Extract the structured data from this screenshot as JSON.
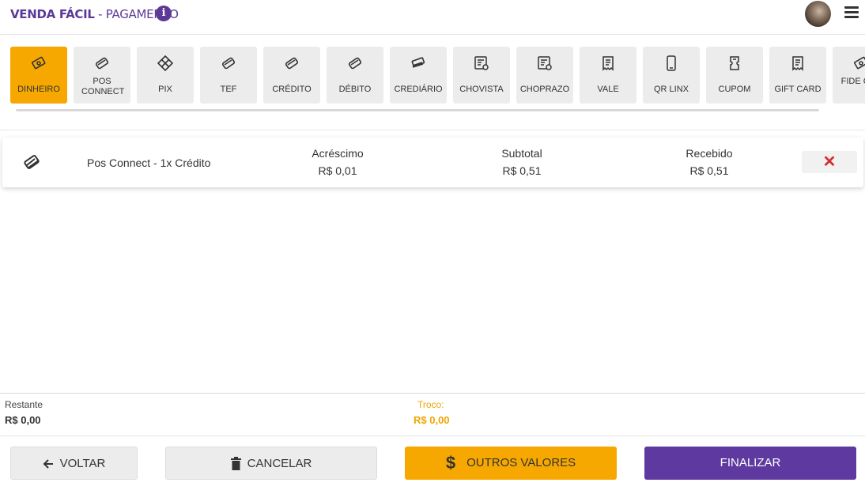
{
  "header": {
    "app_name": "VENDA FÁCIL",
    "separator": " - ",
    "page_name": "PAGAMENTO",
    "info_glyph": "i"
  },
  "methods": [
    {
      "label": "DINHEIRO",
      "icon": "cash-icon",
      "active": true
    },
    {
      "label": "POS CONNECT",
      "icon": "card-icon",
      "active": false
    },
    {
      "label": "PIX",
      "icon": "pix-icon",
      "active": false
    },
    {
      "label": "TEF",
      "icon": "card-icon",
      "active": false
    },
    {
      "label": "CRÉDITO",
      "icon": "card-icon",
      "active": false
    },
    {
      "label": "DÉBITO",
      "icon": "card-icon",
      "active": false
    },
    {
      "label": "CREDIÁRIO",
      "icon": "cards-stack-icon",
      "active": false
    },
    {
      "label": "CHOVISTA",
      "icon": "check-doc-icon",
      "active": false
    },
    {
      "label": "CHOPRAZO",
      "icon": "check-doc-icon",
      "active": false
    },
    {
      "label": "VALE",
      "icon": "receipt-icon",
      "active": false
    },
    {
      "label": "QR LINX",
      "icon": "phone-icon",
      "active": false
    },
    {
      "label": "CUPOM",
      "icon": "coupon-icon",
      "active": false
    },
    {
      "label": "GIFT CARD",
      "icon": "receipt-icon",
      "active": false
    },
    {
      "label": "FIDE CAS",
      "icon": "cash-icon",
      "active": false
    }
  ],
  "payment": {
    "description": "Pos Connect - 1x Crédito",
    "acrescimo_label": "Acréscimo",
    "acrescimo_value": "R$ 0,01",
    "subtotal_label": "Subtotal",
    "subtotal_value": "R$ 0,51",
    "recebido_label": "Recebido",
    "recebido_value": "R$ 0,51",
    "remove_glyph": "✕"
  },
  "totals": {
    "restante_label": "Restante",
    "restante_value": "R$ 0,00",
    "troco_label": "Troco:",
    "troco_value": "R$ 0,00"
  },
  "actions": {
    "voltar": "VOLTAR",
    "cancelar": "CANCELAR",
    "outros": "OUTROS VALORES",
    "finalizar": "FINALIZAR"
  },
  "colors": {
    "brand_purple": "#5b3a97",
    "accent_orange": "#f7a800",
    "remove_red": "#d32f2f"
  }
}
